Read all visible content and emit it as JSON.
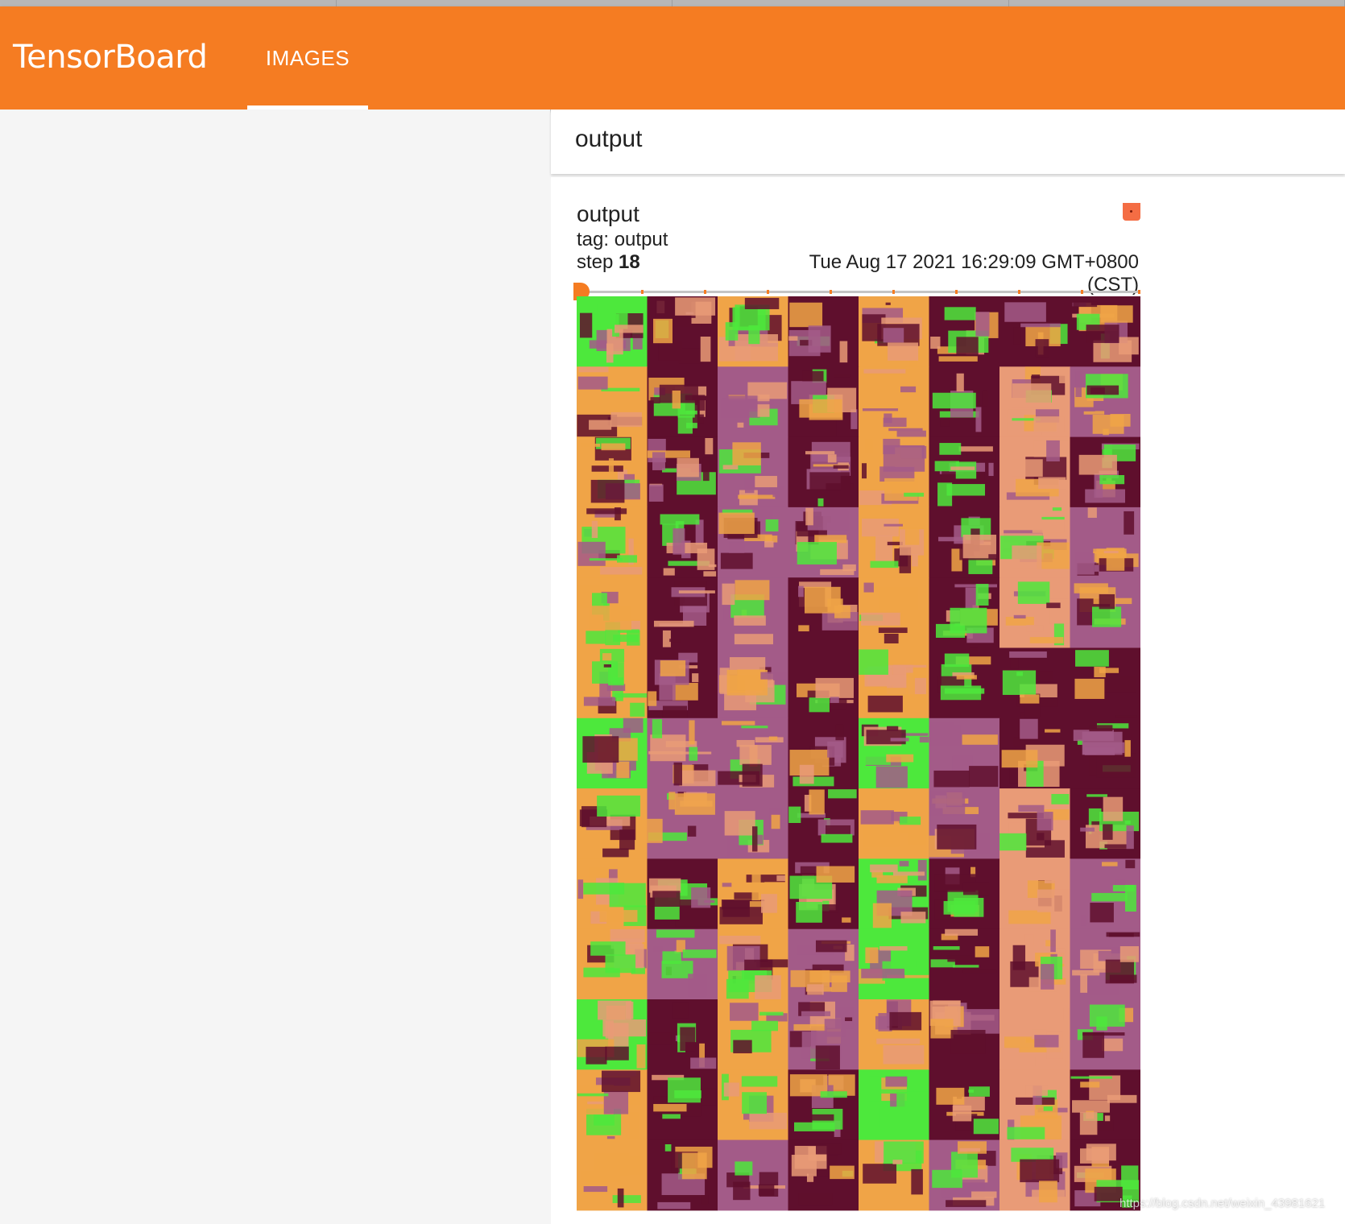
{
  "app": {
    "brand": "TensorBoard"
  },
  "nav": {
    "tabs": [
      {
        "label": "IMAGES",
        "active": true
      }
    ]
  },
  "group": {
    "title": "output"
  },
  "card": {
    "title": "output",
    "tag_line": "tag: output",
    "step_label": "step ",
    "step_value": "18",
    "timestamp": "Tue Aug 17 2021 16:29:09 GMT+0800 (CST)",
    "slider_position": 0
  },
  "image_grid": {
    "rows": 13,
    "cols": 8,
    "palette": [
      "#f0a447",
      "#5f0f2d",
      "#4de83c",
      "#a35b88",
      "#e99b77"
    ]
  },
  "watermark": "https://blog.csdn.net/weixin_43981621",
  "colors": {
    "accent": "#f57c22",
    "badge": "#f46d44"
  }
}
